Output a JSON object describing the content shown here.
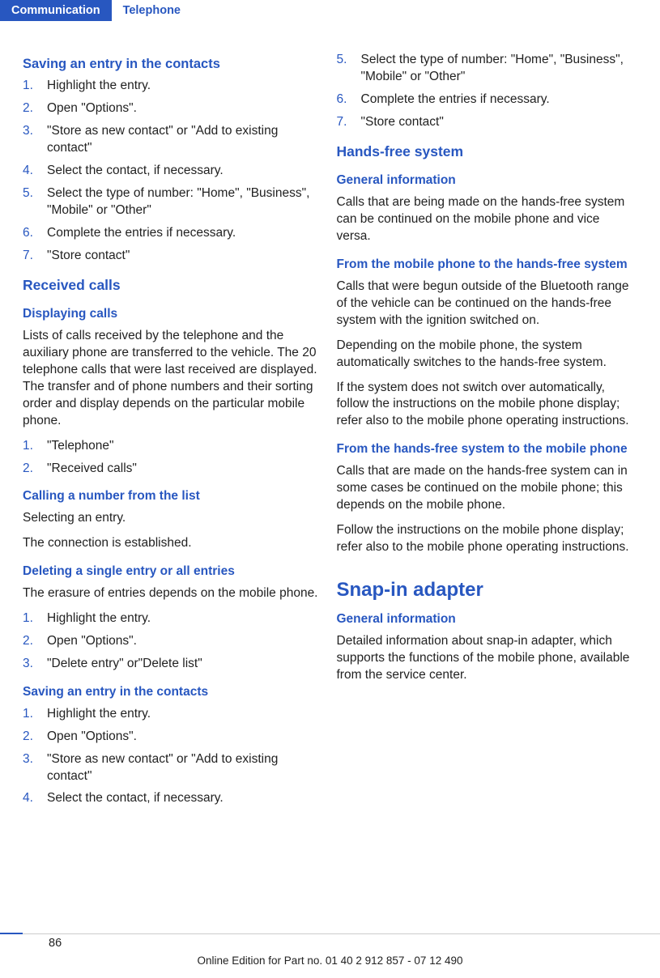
{
  "header": {
    "tab_active": "Communication",
    "tab_inactive": "Telephone"
  },
  "left": {
    "h1": "Saving an entry in the contacts",
    "list1": [
      "Highlight the entry.",
      "Open \"Options\".",
      "\"Store as new contact\" or \"Add to existing contact\"",
      "Select the contact, if necessary.",
      "Select the type of number: \"Home\", \"Business\", \"Mobile\" or \"Other\"",
      "Complete the entries if necessary.",
      "\"Store contact\""
    ],
    "h2": "Received calls",
    "h3": "Displaying calls",
    "p1": "Lists of calls received by the telephone and the auxiliary phone are transferred to the vehicle. The 20 telephone calls that were last received are displayed. The transfer and of phone numbers and their sorting order and display depends on the particular mobile phone.",
    "list2": [
      "\"Telephone\"",
      "\"Received calls\""
    ],
    "h4": "Calling a number from the list",
    "p2": "Selecting an entry.",
    "p3": "The connection is established.",
    "h5": "Deleting a single entry or all entries",
    "p4": "The erasure of entries depends on the mobile phone.",
    "list3": [
      "Highlight the entry.",
      "Open \"Options\".",
      "\"Delete entry\" or\"Delete list\""
    ],
    "h6": "Saving an entry in the contacts",
    "list4": [
      "Highlight the entry.",
      "Open \"Options\".",
      "\"Store as new contact\" or \"Add to existing contact\"",
      "Select the contact, if necessary."
    ]
  },
  "right": {
    "list1": [
      "Select the type of number: \"Home\", \"Business\", \"Mobile\" or \"Other\"",
      "Complete the entries if necessary.",
      "\"Store contact\""
    ],
    "h1": "Hands-free system",
    "h2": "General information",
    "p1": "Calls that are being made on the hands-free system can be continued on the mobile phone and vice versa.",
    "h3": "From the mobile phone to the hands-free system",
    "p2": "Calls that were begun outside of the Bluetooth range of the vehicle can be continued on the hands-free system with the ignition switched on.",
    "p3": "Depending on the mobile phone, the system automatically switches to the hands-free system.",
    "p4": "If the system does not switch over automatically, follow the instructions on the mobile phone display; refer also to the mobile phone operating instructions.",
    "h4": "From the hands-free system to the mobile phone",
    "p5": "Calls that are made on the hands-free system can in some cases be continued on the mobile phone; this depends on the mobile phone.",
    "p6": "Follow the instructions on the mobile phone display; refer also to the mobile phone operating instructions.",
    "h5": "Snap-in adapter",
    "h6": "General information",
    "p7": "Detailed information about snap-in adapter, which supports the functions of the mobile phone, available from the service center."
  },
  "footer": {
    "page": "86",
    "text": "Online Edition for Part no. 01 40 2 912 857 - 07 12 490"
  }
}
